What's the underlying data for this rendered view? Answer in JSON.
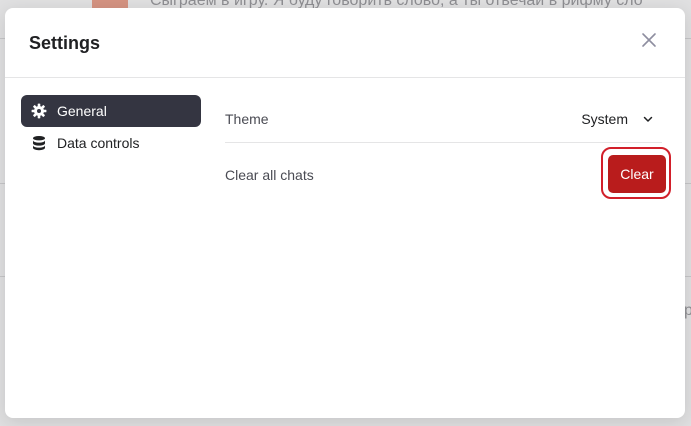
{
  "background": {
    "chat_preview_text": "Сыграем в игру. Я буду говорить слово, а ты отвечай в рифму сло",
    "edge_char": "р"
  },
  "modal": {
    "title": "Settings",
    "close_icon": "close-icon"
  },
  "sidebar": {
    "items": [
      {
        "label": "General",
        "icon": "gear-icon",
        "active": true
      },
      {
        "label": "Data controls",
        "icon": "database-icon",
        "active": false
      }
    ]
  },
  "general": {
    "theme_label": "Theme",
    "theme_value": "System",
    "clear_chats_label": "Clear all chats",
    "clear_button_label": "Clear"
  },
  "colors": {
    "active_nav_bg": "#343541",
    "danger": "#b91c1c",
    "danger_ring": "#d21f2a"
  }
}
